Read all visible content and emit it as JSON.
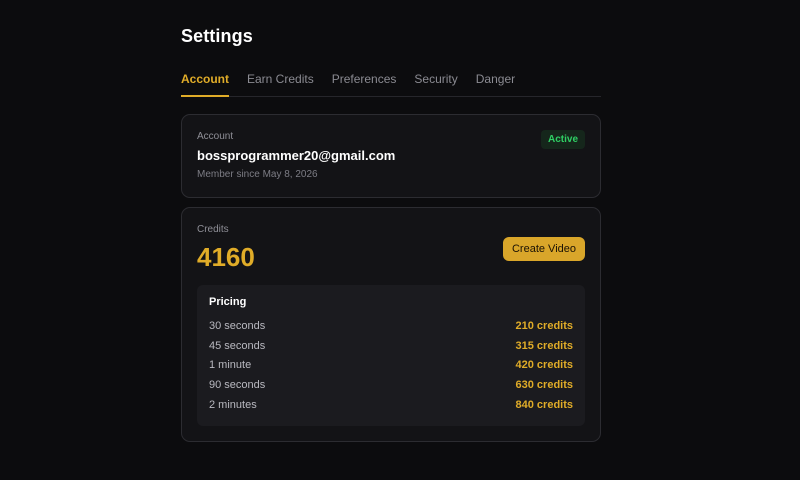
{
  "header": {
    "title": "Settings"
  },
  "tabs": [
    {
      "label": "Account",
      "active": true
    },
    {
      "label": "Earn Credits",
      "active": false
    },
    {
      "label": "Preferences",
      "active": false
    },
    {
      "label": "Security",
      "active": false
    },
    {
      "label": "Danger",
      "active": false
    }
  ],
  "account": {
    "label": "Account",
    "email": "bossprogrammer20@gmail.com",
    "member_since": "Member since May 8, 2026",
    "status": "Active",
    "status_color": "#2fcf64"
  },
  "credits": {
    "label": "Credits",
    "value": "4160",
    "button_label": "Create Video",
    "accent_color": "#e0ac28"
  },
  "pricing": {
    "title": "Pricing",
    "rows": [
      {
        "duration": "30 seconds",
        "cost": "210 credits"
      },
      {
        "duration": "45 seconds",
        "cost": "315 credits"
      },
      {
        "duration": "1 minute",
        "cost": "420 credits"
      },
      {
        "duration": "90 seconds",
        "cost": "630 credits"
      },
      {
        "duration": "2 minutes",
        "cost": "840 credits"
      }
    ]
  }
}
